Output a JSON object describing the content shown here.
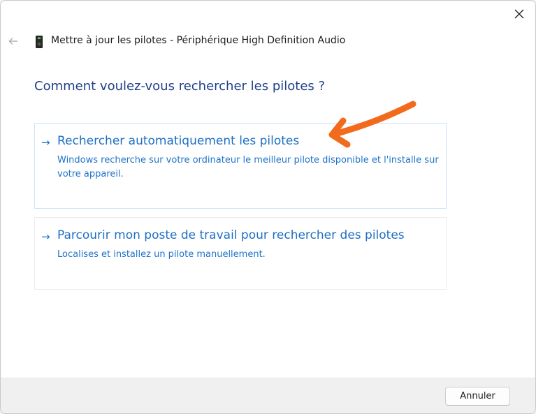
{
  "window": {
    "title": "Mettre à jour les pilotes - Périphérique High Definition Audio",
    "close_icon": "close-icon",
    "back_icon": "arrow-left-icon",
    "device_icon": "speaker-device-icon"
  },
  "main": {
    "heading": "Comment voulez-vous rechercher les pilotes ?",
    "options": [
      {
        "arrow": "→",
        "title": "Rechercher automatiquement les pilotes",
        "description": "Windows recherche sur votre ordinateur le meilleur pilote disponible et l'installe sur votre appareil."
      },
      {
        "arrow": "→",
        "title": "Parcourir mon poste de travail pour rechercher des pilotes",
        "description": "Localises et installez un pilote manuellement."
      }
    ]
  },
  "footer": {
    "cancel_label": "Annuler"
  },
  "colors": {
    "accent": "#1e6fc4",
    "heading": "#1f3f86",
    "annotation_arrow": "#f26b1d"
  }
}
